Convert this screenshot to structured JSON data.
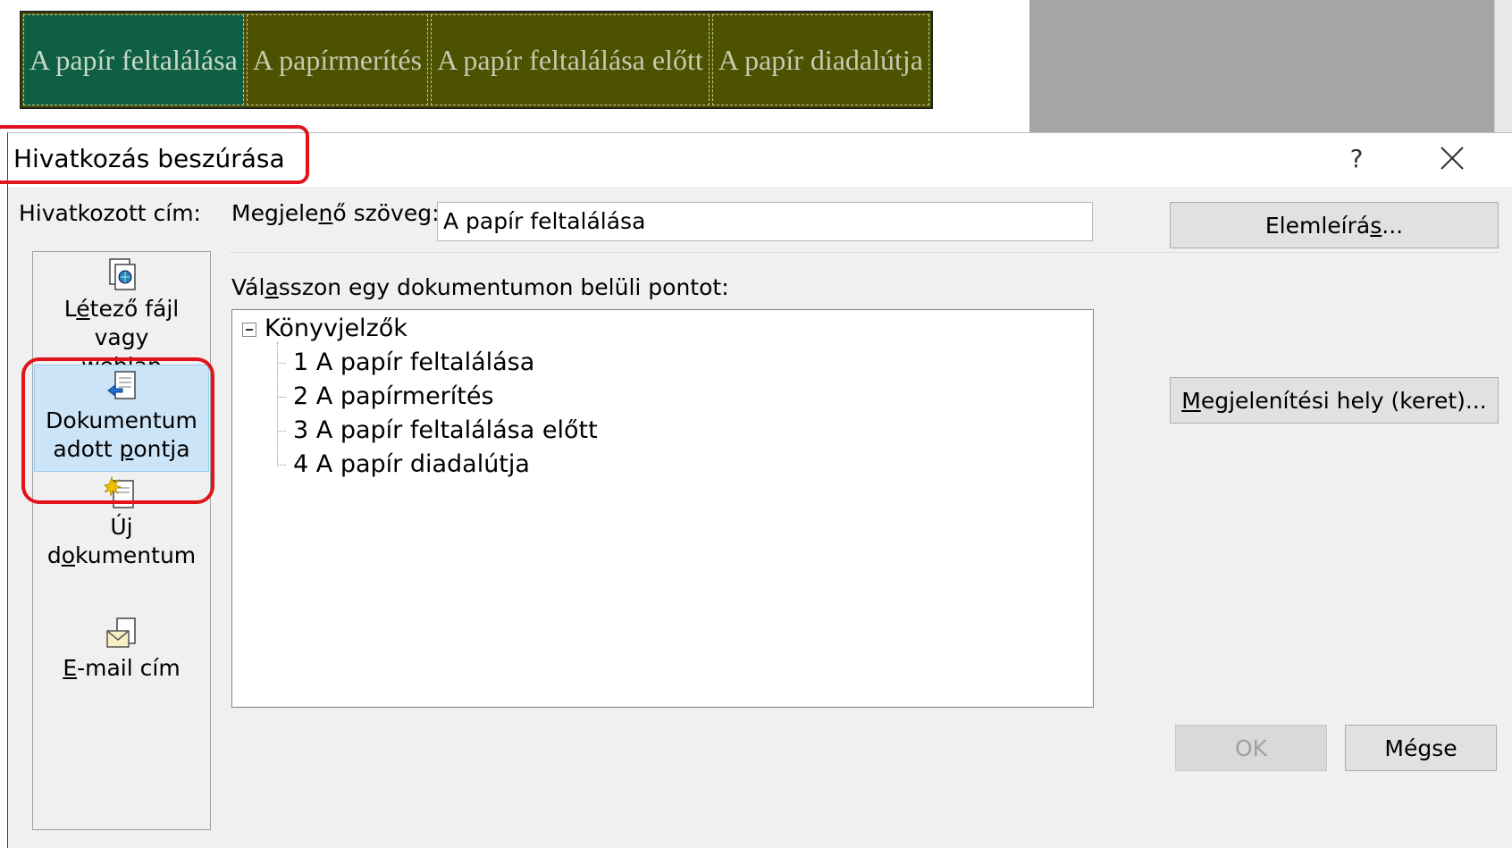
{
  "document": {
    "tabs": [
      "A papír feltalálása",
      "A papírmerítés",
      "A papír feltalálása előtt",
      "A papír diadalútja"
    ]
  },
  "dialog": {
    "title": "Hivatkozás beszúrása",
    "help": "?",
    "link_to_label": "Hivatkozott cím:",
    "display_text_label": "Megjelenő szöveg:",
    "display_text_value": "A papír feltalálása",
    "screentip_button": "Elemleírás...",
    "select_place_label": "Válasszon egy dokumentumon belüli pontot:",
    "target_frame_button": "Megjelenítési hely (keret)...",
    "ok_button": "OK",
    "cancel_button": "Mégse",
    "nav": [
      {
        "label_line1": "Létező fájl vagy",
        "label_line2": "weblap",
        "icon": "existing-file-icon"
      },
      {
        "label_line1": "Dokumentum",
        "label_line2": "adott pontja",
        "icon": "place-in-document-icon",
        "selected": true
      },
      {
        "label_line1": "Új",
        "label_line2": "dokumentum",
        "icon": "new-document-icon"
      },
      {
        "label_line1": "E-mail cím",
        "icon": "email-icon"
      }
    ],
    "tree": {
      "root": "Könyvjelzők",
      "items": [
        "1 A papír feltalálása",
        "2 A papírmerítés",
        "3 A papír feltalálása előtt",
        "4 A papír diadalútja"
      ]
    }
  },
  "colors": {
    "highlight_red": "#e0141a",
    "selected_nav": "#cce4f7",
    "doc_table_bg": "#4c5200",
    "doc_active_cell": "#0f5f45"
  }
}
